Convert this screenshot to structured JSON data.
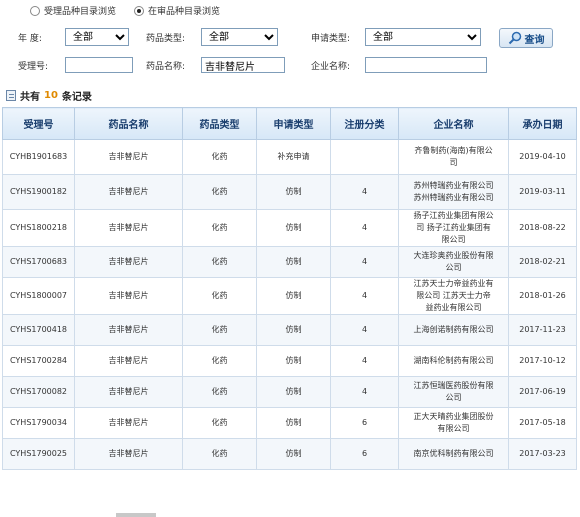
{
  "radios": [
    {
      "label": "受理品种目录浏览",
      "checked": false
    },
    {
      "label": "在审品种目录浏览",
      "checked": true
    }
  ],
  "filters": {
    "year_label": "年   度:",
    "year_value": "全部",
    "type_label": "药品类型:",
    "type_value": "全部",
    "apply_label": "申请类型:",
    "apply_value": "全部",
    "query_button": "查询",
    "accept_no_label": "受理号:",
    "accept_no_value": "",
    "drug_name_label": "药品名称:",
    "drug_name_value": "吉非替尼片",
    "company_label": "企业名称:",
    "company_value": ""
  },
  "summary": {
    "prefix": "共有",
    "count": "10",
    "suffix": "条记录"
  },
  "table": {
    "headers": [
      "受理号",
      "药品名称",
      "药品类型",
      "申请类型",
      "注册分类",
      "企业名称",
      "承办日期"
    ],
    "rows": [
      [
        "CYHB1901683",
        "吉非替尼片",
        "化药",
        "补充申请",
        "",
        "齐鲁制药(海南)有限公司",
        "2019-04-10"
      ],
      [
        "CYHS1900182",
        "吉非替尼片",
        "化药",
        "仿制",
        "4",
        "苏州特瑞药业有限公司 苏州特瑞药业有限公司",
        "2019-03-11"
      ],
      [
        "CYHS1800218",
        "吉非替尼片",
        "化药",
        "仿制",
        "4",
        "扬子江药业集团有限公司 扬子江药业集团有限公司",
        "2018-08-22"
      ],
      [
        "CYHS1700683",
        "吉非替尼片",
        "化药",
        "仿制",
        "4",
        "大连珍奥药业股份有限公司",
        "2018-02-21"
      ],
      [
        "CYHS1800007",
        "吉非替尼片",
        "化药",
        "仿制",
        "4",
        "江苏天士力帝益药业有限公司 江苏天士力帝益药业有限公司",
        "2018-01-26"
      ],
      [
        "CYHS1700418",
        "吉非替尼片",
        "化药",
        "仿制",
        "4",
        "上海创诺制药有限公司",
        "2017-11-23"
      ],
      [
        "CYHS1700284",
        "吉非替尼片",
        "化药",
        "仿制",
        "4",
        "湖南科伦制药有限公司",
        "2017-10-12"
      ],
      [
        "CYHS1700082",
        "吉非替尼片",
        "化药",
        "仿制",
        "4",
        "江苏恒瑞医药股份有限公司",
        "2017-06-19"
      ],
      [
        "CYHS1790034",
        "吉非替尼片",
        "化药",
        "仿制",
        "6",
        "正大天晴药业集团股份有限公司",
        "2017-05-18"
      ],
      [
        "CYHS1790025",
        "吉非替尼片",
        "化药",
        "仿制",
        "6",
        "南京优科制药有限公司",
        "2017-03-23"
      ]
    ]
  }
}
